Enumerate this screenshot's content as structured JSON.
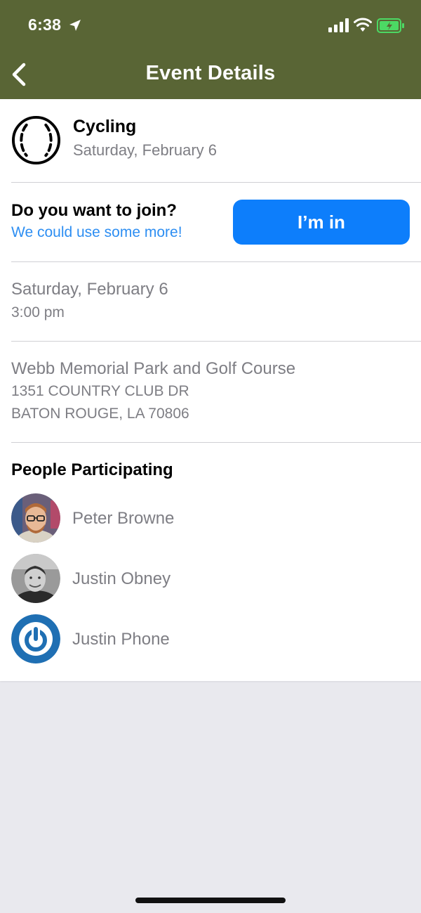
{
  "status_bar": {
    "time": "6:38"
  },
  "nav": {
    "title": "Event Details",
    "back_icon": "chevron-left-icon"
  },
  "colors": {
    "nav_bg": "#596535",
    "accent": "#0d7efb",
    "link": "#2d8ef2",
    "battery": "#4cd964"
  },
  "event": {
    "icon": "ball-icon",
    "title": "Cycling",
    "date": "Saturday, February 6"
  },
  "join": {
    "question": "Do you want to join?",
    "subtitle": "We could use some more!",
    "button_label": "I’m in"
  },
  "when": {
    "date": "Saturday, February 6",
    "time": "3:00 pm"
  },
  "location": {
    "name": "Webb Memorial Park and Golf Course",
    "address_line1": "1351 COUNTRY CLUB DR",
    "address_line2": "BATON ROUGE, LA 70806"
  },
  "people": {
    "heading": "People Participating",
    "list": [
      {
        "name": "Peter Browne"
      },
      {
        "name": "Justin Obney"
      },
      {
        "name": "Justin Phone"
      }
    ]
  }
}
